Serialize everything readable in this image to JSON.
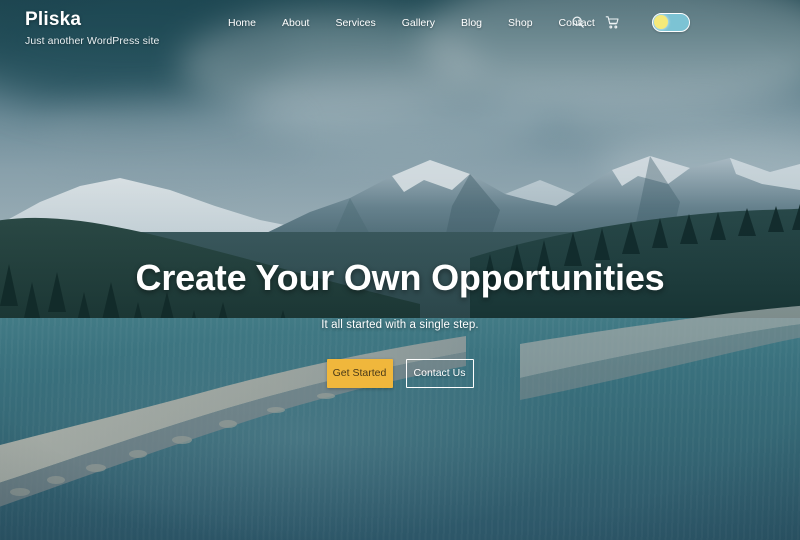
{
  "site": {
    "brand": "Pliska",
    "tagline": "Just another WordPress site"
  },
  "nav": {
    "items": [
      {
        "label": "Home"
      },
      {
        "label": "About"
      },
      {
        "label": "Services"
      },
      {
        "label": "Gallery"
      },
      {
        "label": "Blog"
      },
      {
        "label": "Shop"
      },
      {
        "label": "Contact"
      }
    ]
  },
  "actions": {
    "search_icon": "search-icon",
    "cart_icon": "shopping-cart-icon",
    "theme_toggle": {
      "name": "theme-toggle",
      "state": "light",
      "knob_color": "#f5ea7a",
      "track_color": "#7cc3d4"
    }
  },
  "hero": {
    "title": "Create Your Own Opportunities",
    "subtitle": "It all started with a single step.",
    "primary_button": "Get Started",
    "secondary_button": "Contact Us"
  },
  "colors": {
    "accent": "#f0b73c",
    "text_on_hero": "#ffffff",
    "header_bg": "#2a5862",
    "water": "#3f7986",
    "sky_top": "#2d5a64",
    "sky_bottom": "#a6b8c0",
    "forest": "#24423f"
  }
}
